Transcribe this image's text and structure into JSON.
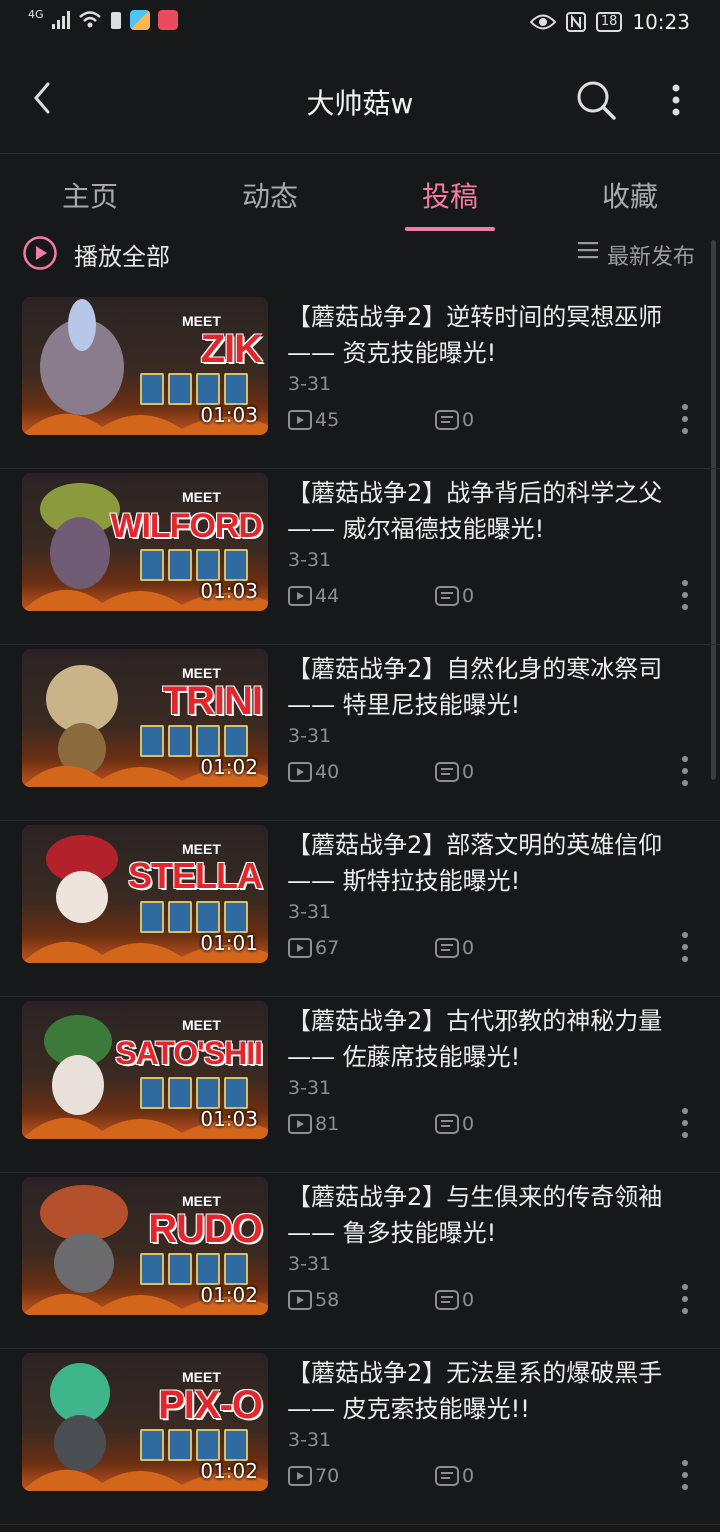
{
  "status": {
    "network": "4G",
    "time": "10:23",
    "battery": "18"
  },
  "header": {
    "title": "大帅菇w"
  },
  "tabs": [
    {
      "label": "主页"
    },
    {
      "label": "动态"
    },
    {
      "label": "投稿",
      "active": true
    },
    {
      "label": "收藏"
    }
  ],
  "toolbar": {
    "play_all": "播放全部",
    "sort": "最新发布"
  },
  "colors": {
    "accent": "#f27ca2",
    "background": "#17181a"
  },
  "videos": [
    {
      "thumb_text": "ZIK",
      "duration": "01:03",
      "title": "【蘑菇战争2】逆转时间的冥想巫师 —— 资克技能曝光!",
      "date": "3-31",
      "views": "45",
      "comments": "0"
    },
    {
      "thumb_text": "WILFORD",
      "duration": "01:03",
      "title": "【蘑菇战争2】战争背后的科学之父 —— 威尔福德技能曝光!",
      "date": "3-31",
      "views": "44",
      "comments": "0"
    },
    {
      "thumb_text": "TRINI",
      "duration": "01:02",
      "title": "【蘑菇战争2】自然化身的寒冰祭司 —— 特里尼技能曝光!",
      "date": "3-31",
      "views": "40",
      "comments": "0"
    },
    {
      "thumb_text": "STELLA",
      "duration": "01:01",
      "title": "【蘑菇战争2】部落文明的英雄信仰 —— 斯特拉技能曝光!",
      "date": "3-31",
      "views": "67",
      "comments": "0"
    },
    {
      "thumb_text": "SATO'SHII",
      "duration": "01:03",
      "title": "【蘑菇战争2】古代邪教的神秘力量 —— 佐藤席技能曝光!",
      "date": "3-31",
      "views": "81",
      "comments": "0"
    },
    {
      "thumb_text": "RUDO",
      "duration": "01:02",
      "title": "【蘑菇战争2】与生俱来的传奇领袖 —— 鲁多技能曝光!",
      "date": "3-31",
      "views": "58",
      "comments": "0"
    },
    {
      "thumb_text": "PIX-O",
      "duration": "01:02",
      "title": "【蘑菇战争2】无法星系的爆破黑手 —— 皮克索技能曝光!!",
      "date": "3-31",
      "views": "70",
      "comments": "0"
    }
  ]
}
